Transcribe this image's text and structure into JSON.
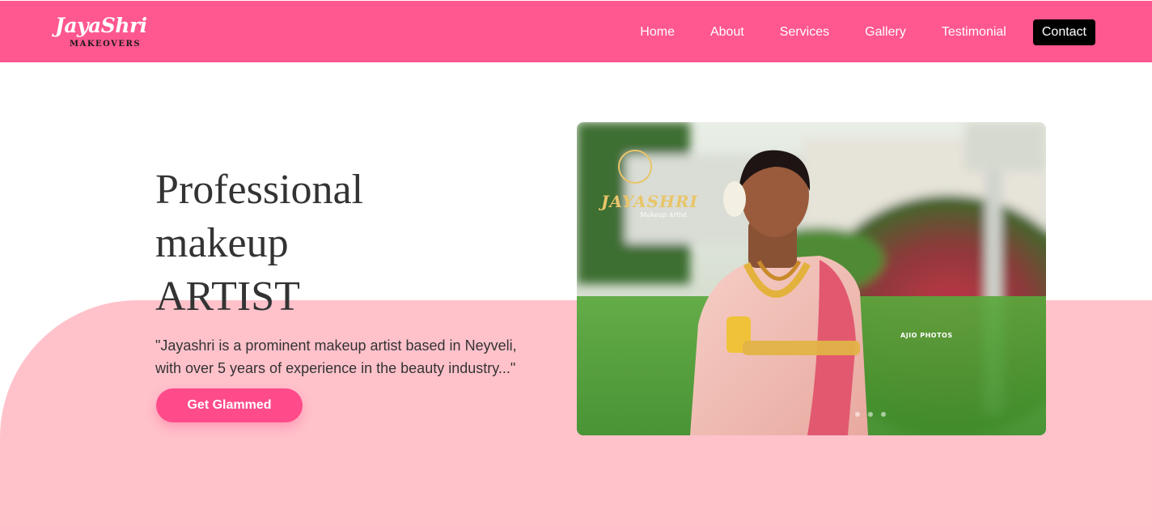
{
  "header": {
    "logo_script": "JayaShri",
    "logo_sub": "MAKEOVERS",
    "nav": [
      {
        "label": "Home"
      },
      {
        "label": "About"
      },
      {
        "label": "Services"
      },
      {
        "label": "Gallery"
      },
      {
        "label": "Testimonial"
      }
    ],
    "contact_label": "Contact"
  },
  "hero": {
    "title_line1": "Professional",
    "title_line2": "makeup",
    "title_line3": "ARTIST",
    "quote": "\"Jayashri is a prominent makeup artist based in Neyveli, with over 5 years of experience in the beauty industry...\"",
    "cta_label": "Get Glammed"
  },
  "photo": {
    "watermark_brand": "JAYASHRI",
    "watermark_brand_sub": "Makeup Artist",
    "watermark_photographer": "AJIO PHOTOS",
    "carousel_slides": 3,
    "active_slide": 1
  },
  "colors": {
    "navbar": "#ff5790",
    "accent": "#ff4b8a",
    "pink_band": "#ffc2cb",
    "contact_button": "#000000",
    "text": "#333333"
  }
}
